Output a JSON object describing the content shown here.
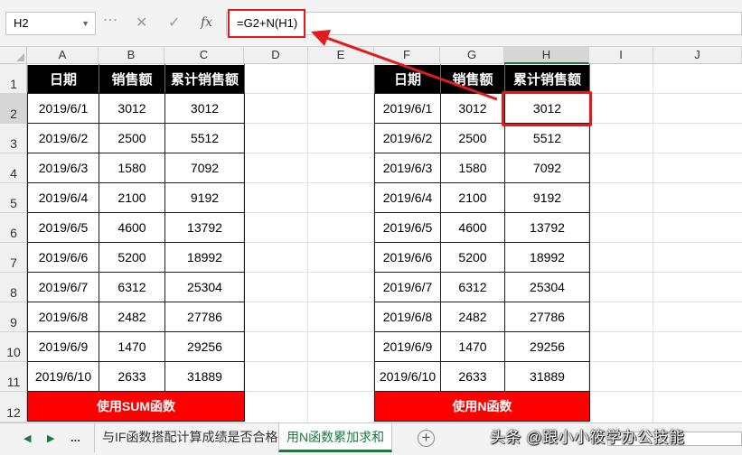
{
  "formula_bar": {
    "name_box": "H2",
    "cancel_glyph": "✕",
    "enter_glyph": "✓",
    "fx_label": "fx",
    "formula": "=G2+N(H1)"
  },
  "columns": [
    "A",
    "B",
    "C",
    "D",
    "E",
    "F",
    "G",
    "H",
    "I",
    "J"
  ],
  "rows": [
    "1",
    "2",
    "3",
    "4",
    "5",
    "6",
    "7",
    "8",
    "9",
    "10",
    "11",
    "12"
  ],
  "left_table": {
    "headers": [
      "日期",
      "销售额",
      "累计销售额"
    ],
    "rows": [
      [
        "2019/6/1",
        "3012",
        "3012"
      ],
      [
        "2019/6/2",
        "2500",
        "5512"
      ],
      [
        "2019/6/3",
        "1580",
        "7092"
      ],
      [
        "2019/6/4",
        "2100",
        "9192"
      ],
      [
        "2019/6/5",
        "4600",
        "13792"
      ],
      [
        "2019/6/6",
        "5200",
        "18992"
      ],
      [
        "2019/6/7",
        "6312",
        "25304"
      ],
      [
        "2019/6/8",
        "2482",
        "27786"
      ],
      [
        "2019/6/9",
        "1470",
        "29256"
      ],
      [
        "2019/6/10",
        "2633",
        "31889"
      ]
    ],
    "footer": "使用SUM函数"
  },
  "right_table": {
    "headers": [
      "日期",
      "销售额",
      "累计销售额"
    ],
    "rows": [
      [
        "2019/6/1",
        "3012",
        "3012"
      ],
      [
        "2019/6/2",
        "2500",
        "5512"
      ],
      [
        "2019/6/3",
        "1580",
        "7092"
      ],
      [
        "2019/6/4",
        "2100",
        "9192"
      ],
      [
        "2019/6/5",
        "4600",
        "13792"
      ],
      [
        "2019/6/6",
        "5200",
        "18992"
      ],
      [
        "2019/6/7",
        "6312",
        "25304"
      ],
      [
        "2019/6/8",
        "2482",
        "27786"
      ],
      [
        "2019/6/9",
        "1470",
        "29256"
      ],
      [
        "2019/6/10",
        "2633",
        "31889"
      ]
    ],
    "footer": "使用N函数"
  },
  "sheet_tabs": {
    "ellipsis": "...",
    "tabs": [
      "与IF函数搭配计算成绩是否合格",
      "用N函数累加求和"
    ],
    "active_index": 1,
    "add_glyph": "+"
  },
  "watermark": "头条 @跟小小筱学办公技能",
  "colors": {
    "header_bg": "#000000",
    "footer_bg": "#ff0000",
    "highlight": "#e11b1b",
    "sheet_tab_accent": "#1a7a3c"
  }
}
